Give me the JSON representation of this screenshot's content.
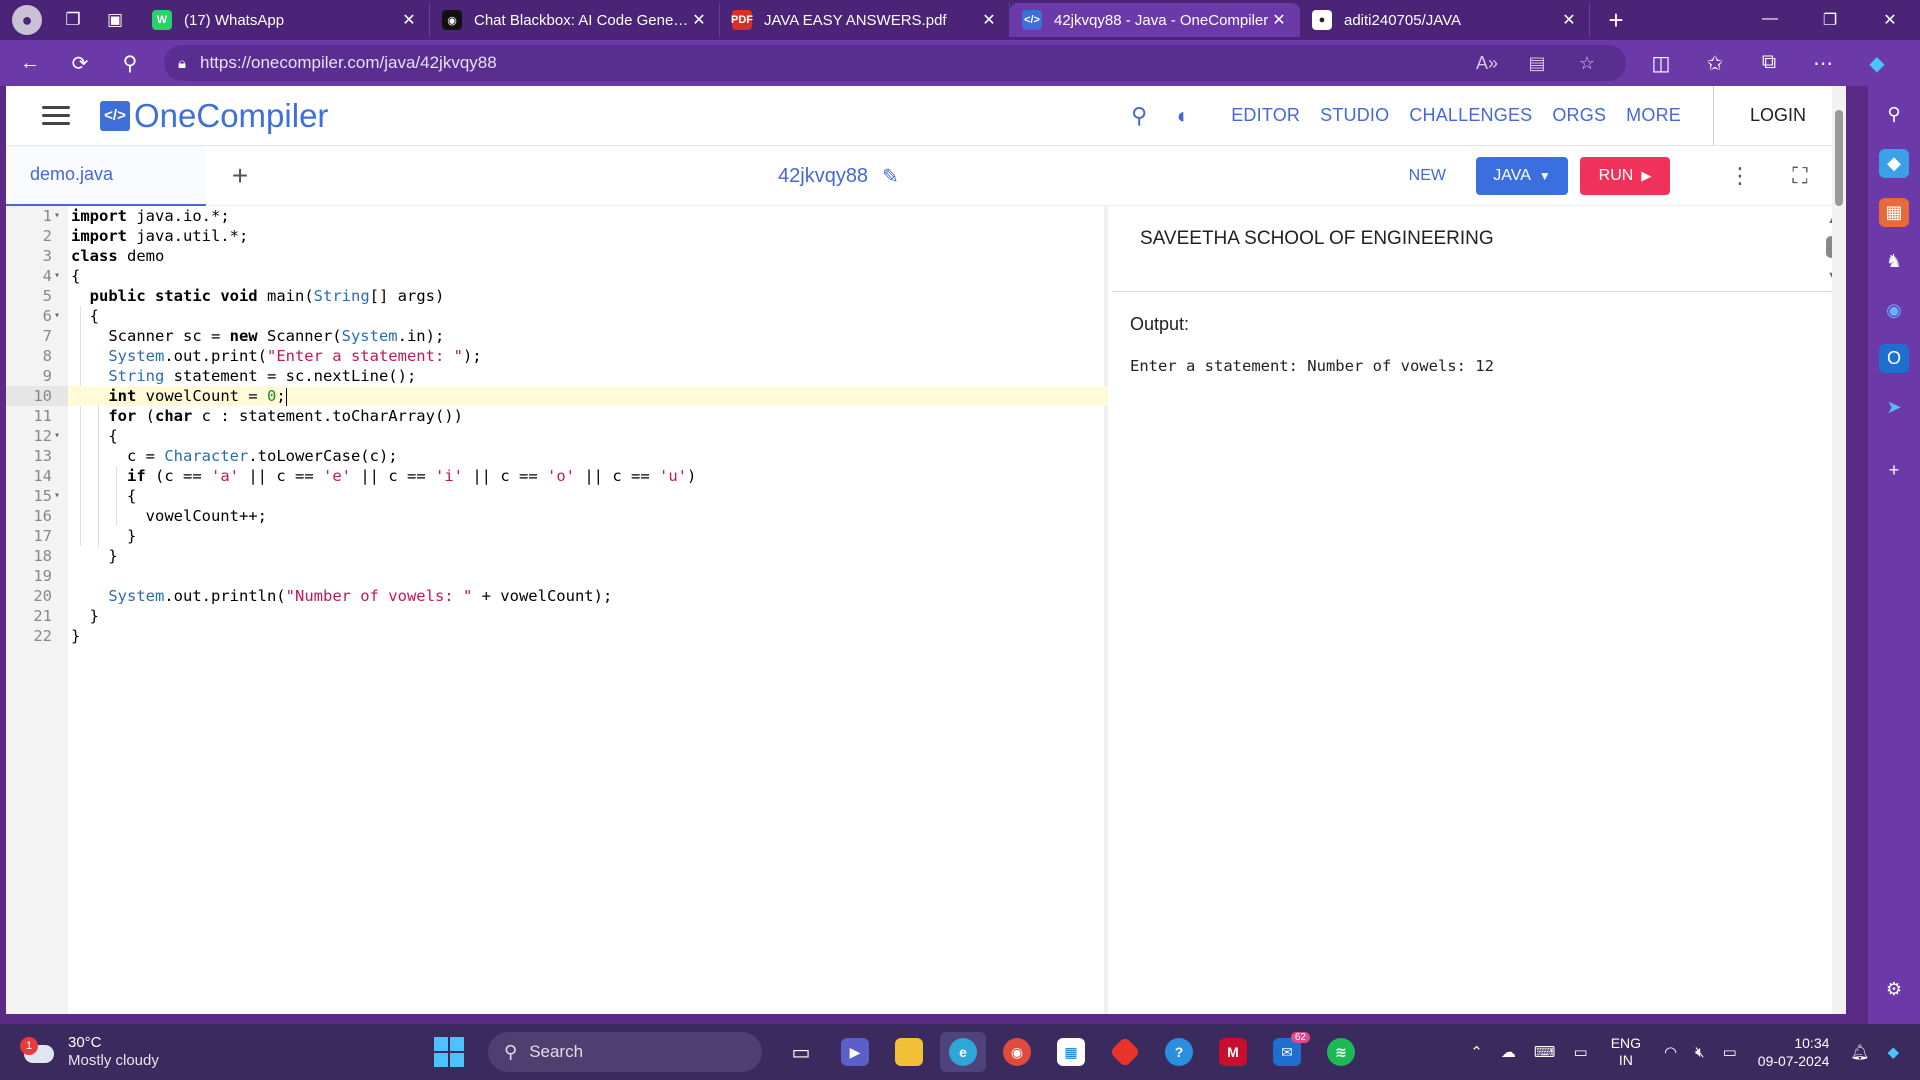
{
  "browser": {
    "tabs": [
      {
        "title": "(17) WhatsApp",
        "icon": "whatsapp-icon",
        "color": "#25d366",
        "glyph": "W"
      },
      {
        "title": "Chat Blackbox: AI Code Generati",
        "icon": "blackbox-icon",
        "color": "#111111",
        "glyph": "◉"
      },
      {
        "title": "JAVA EASY ANSWERS.pdf",
        "icon": "pdf-icon",
        "color": "#d93025",
        "glyph": "PDF"
      },
      {
        "title": "42jkvqy88 - Java - OneCompiler",
        "icon": "onecompiler-icon",
        "color": "#3f6fd8",
        "glyph": "</>"
      },
      {
        "title": "aditi240705/JAVA",
        "icon": "github-icon",
        "color": "#ffffff",
        "glyph": "●"
      }
    ],
    "active_tab": 3,
    "url": "https://onecompiler.com/java/42jkvqy88"
  },
  "header": {
    "logo_glyph": "</>",
    "logo_text": "OneCompiler",
    "nav": [
      "EDITOR",
      "STUDIO",
      "CHALLENGES",
      "ORGS",
      "MORE"
    ],
    "login": "LOGIN"
  },
  "toolbar": {
    "file_tab": "demo.java",
    "add_label": "+",
    "code_id": "42jkvqy88",
    "new_label": "NEW",
    "lang_label": "JAVA",
    "run_label": "RUN"
  },
  "editor": {
    "current_line": 10,
    "lines": [
      {
        "n": "1",
        "fold": true
      },
      {
        "n": "2",
        "fold": false
      },
      {
        "n": "3",
        "fold": false
      },
      {
        "n": "4",
        "fold": true
      },
      {
        "n": "5",
        "fold": false
      },
      {
        "n": "6",
        "fold": true
      },
      {
        "n": "7",
        "fold": false
      },
      {
        "n": "8",
        "fold": false
      },
      {
        "n": "9",
        "fold": false
      },
      {
        "n": "10",
        "fold": false
      },
      {
        "n": "11",
        "fold": false
      },
      {
        "n": "12",
        "fold": true
      },
      {
        "n": "13",
        "fold": false
      },
      {
        "n": "14",
        "fold": false
      },
      {
        "n": "15",
        "fold": true
      },
      {
        "n": "16",
        "fold": false
      },
      {
        "n": "17",
        "fold": false
      },
      {
        "n": "18",
        "fold": false
      },
      {
        "n": "19",
        "fold": false
      },
      {
        "n": "20",
        "fold": false
      },
      {
        "n": "21",
        "fold": false
      },
      {
        "n": "22",
        "fold": false
      }
    ],
    "code": [
      [
        {
          "t": "import",
          "c": "kw"
        },
        {
          "t": " java.io.*;"
        }
      ],
      [
        {
          "t": "import",
          "c": "kw"
        },
        {
          "t": " java.util.*;"
        }
      ],
      [
        {
          "t": "class",
          "c": "kw"
        },
        {
          "t": " demo"
        }
      ],
      [
        {
          "t": "{"
        }
      ],
      [
        {
          "t": "  "
        },
        {
          "t": "public static void",
          "c": "kw"
        },
        {
          "t": " main("
        },
        {
          "t": "String",
          "c": "ty"
        },
        {
          "t": "[] args)"
        }
      ],
      [
        {
          "t": "  {"
        }
      ],
      [
        {
          "t": "    Scanner sc = "
        },
        {
          "t": "new",
          "c": "kw"
        },
        {
          "t": " Scanner("
        },
        {
          "t": "System",
          "c": "ty"
        },
        {
          "t": ".in);"
        }
      ],
      [
        {
          "t": "    "
        },
        {
          "t": "System",
          "c": "ty"
        },
        {
          "t": ".out.print("
        },
        {
          "t": "\"Enter a statement: \"",
          "c": "str"
        },
        {
          "t": ");"
        }
      ],
      [
        {
          "t": "    "
        },
        {
          "t": "String",
          "c": "ty"
        },
        {
          "t": " statement = sc.nextLine();"
        }
      ],
      [
        {
          "t": "    "
        },
        {
          "t": "int",
          "c": "kw"
        },
        {
          "t": " vowelCount = "
        },
        {
          "t": "0",
          "c": "num"
        },
        {
          "t": ";"
        }
      ],
      [
        {
          "t": "    "
        },
        {
          "t": "for",
          "c": "kw"
        },
        {
          "t": " ("
        },
        {
          "t": "char",
          "c": "kw"
        },
        {
          "t": " c : statement.toCharArray())"
        }
      ],
      [
        {
          "t": "    {"
        }
      ],
      [
        {
          "t": "      c = "
        },
        {
          "t": "Character",
          "c": "ty"
        },
        {
          "t": ".toLowerCase(c);"
        }
      ],
      [
        {
          "t": "      "
        },
        {
          "t": "if",
          "c": "kw"
        },
        {
          "t": " (c == "
        },
        {
          "t": "'a'",
          "c": "str"
        },
        {
          "t": " || c == "
        },
        {
          "t": "'e'",
          "c": "str"
        },
        {
          "t": " || c == "
        },
        {
          "t": "'i'",
          "c": "str"
        },
        {
          "t": " || c == "
        },
        {
          "t": "'o'",
          "c": "str"
        },
        {
          "t": " || c == "
        },
        {
          "t": "'u'",
          "c": "str"
        },
        {
          "t": ")"
        }
      ],
      [
        {
          "t": "      {"
        }
      ],
      [
        {
          "t": "        vowelCount++;"
        }
      ],
      [
        {
          "t": "      }"
        }
      ],
      [
        {
          "t": "    }"
        }
      ],
      [
        {
          "t": ""
        }
      ],
      [
        {
          "t": "    "
        },
        {
          "t": "System",
          "c": "ty"
        },
        {
          "t": ".out.println("
        },
        {
          "t": "\"Number of vowels: \"",
          "c": "str"
        },
        {
          "t": " + vowelCount);"
        }
      ],
      [
        {
          "t": "  }"
        }
      ],
      [
        {
          "t": "}"
        }
      ]
    ]
  },
  "output": {
    "stdin_text": "SAVEETHA SCHOOL OF ENGINEERING",
    "label": "Output:",
    "text": "Enter a statement: Number of vowels: 12"
  },
  "taskbar": {
    "weather_badge": "1",
    "temp": "30°C",
    "condition": "Mostly cloudy",
    "search_label": "Search",
    "mail_count": "62",
    "lang_top": "ENG",
    "lang_bottom": "IN",
    "time": "10:34",
    "date": "09-07-2024"
  },
  "colors": {
    "accent": "#4468d6",
    "run": "#f0325a",
    "java_button": "#3b6fe0",
    "browser_frame": "#6c3aa8"
  }
}
